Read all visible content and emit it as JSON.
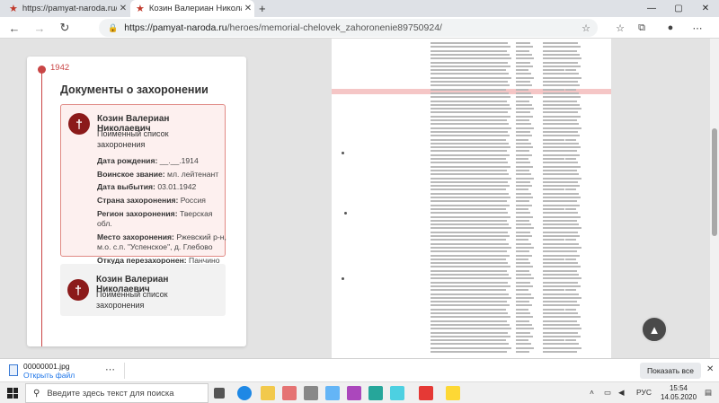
{
  "browser": {
    "tabs": [
      {
        "title": "https://pamyat-naroda.ru/heroes"
      },
      {
        "title": "Козин Валериан Николаевич"
      }
    ],
    "new_tab": "+",
    "window_controls": {
      "minimize": "—",
      "restore": "▢",
      "close": "✕"
    },
    "nav": {
      "back": "←",
      "forward": "→",
      "refresh": "↻"
    },
    "url_host": "https://pamyat-naroda.ru",
    "url_path": "/heroes/memorial-chelovek_zahoronenie89750924/"
  },
  "panel": {
    "year": "1942",
    "title": "Документы о захоронении",
    "card1": {
      "name": "Козин Валериан Николаевич",
      "type": "Поименный список захоронения",
      "fields": [
        {
          "label": "Дата рождения:",
          "value": "__.__.1914"
        },
        {
          "label": "Воинское звание:",
          "value": "мл. лейтенант"
        },
        {
          "label": "Дата выбытия:",
          "value": "03.01.1942"
        },
        {
          "label": "Страна захоронения:",
          "value": "Россия"
        },
        {
          "label": "Регион захоронения:",
          "value": "Тверская обл."
        },
        {
          "label": "Место захоронения:",
          "value": "Ржевский р-н, м.о. с.п. \"Успенское\", д. Глебово"
        },
        {
          "label": "Откуда перезахоронен:",
          "value": "Панчино"
        }
      ]
    },
    "card2": {
      "name": "Козин Валериан Николаевич",
      "type": "Поименный список захоронения"
    }
  },
  "downloads": {
    "file_name": "00000001.jpg",
    "open_label": "Открыть файл",
    "show_all": "Показать все"
  },
  "taskbar": {
    "search_placeholder": "Введите здесь текст для поиска",
    "language": "РУС",
    "time": "15:54",
    "date": "14.05.2020"
  },
  "colors": {
    "accent": "#c94545",
    "cross": "#8b1a1a",
    "highlight": "#f5c6c6"
  }
}
